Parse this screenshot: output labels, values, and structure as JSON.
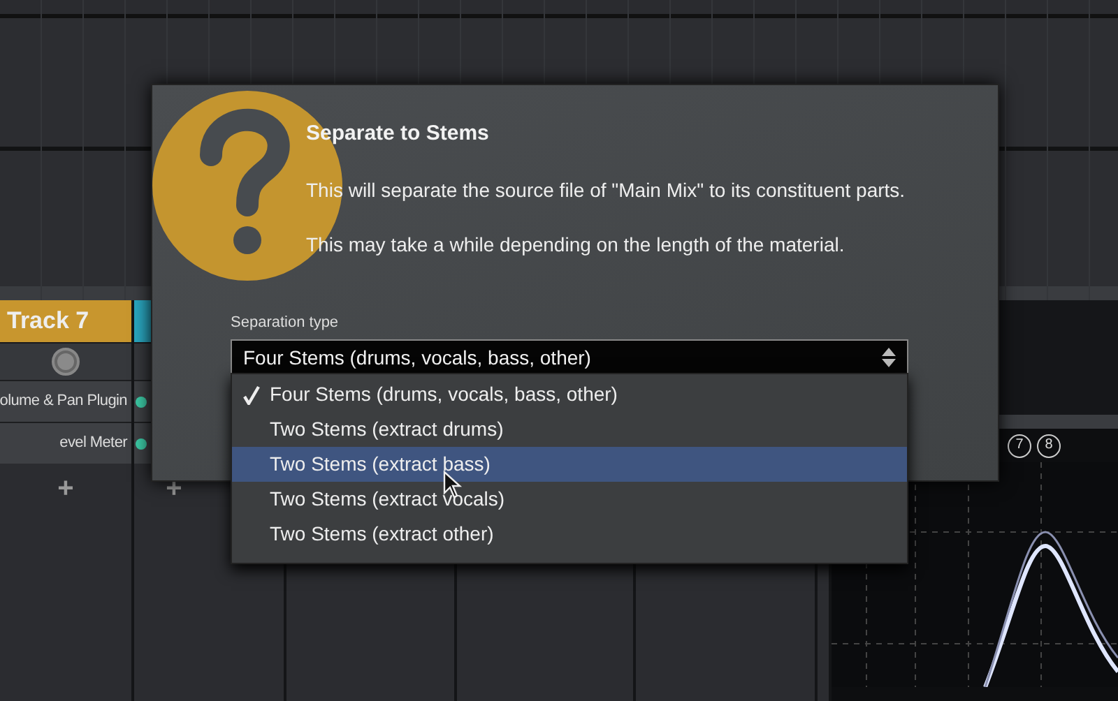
{
  "mixer": {
    "tracks": [
      {
        "name": "Track 7",
        "color": "#c8962e",
        "plugins": [
          {
            "name": "olume & Pan Plugin"
          },
          {
            "name": "evel Meter"
          }
        ],
        "add": "+"
      },
      {
        "color": "#2aa7c0",
        "plugins": [
          {
            "color": "#3cc9a5"
          },
          {
            "color": "#3cc9a5"
          }
        ],
        "add": "+"
      }
    ]
  },
  "eq": {
    "bands": [
      "7",
      "8"
    ]
  },
  "dialog": {
    "title": "Separate to Stems",
    "messages": [
      "This will separate the source file of \"Main Mix\" to its constituent parts.",
      "This may take a while depending on the length of the material."
    ],
    "field_label": "Separation type",
    "select": {
      "value": "Four Stems (drums, vocals, bass, other)"
    },
    "menu": [
      {
        "label": "Four Stems (drums, vocals, bass, other)",
        "checked": true,
        "selected": false
      },
      {
        "label": "Two Stems (extract drums)",
        "checked": false,
        "selected": false
      },
      {
        "label": "Two Stems (extract bass)",
        "checked": false,
        "selected": true
      },
      {
        "label": "Two Stems (extract vocals)",
        "checked": false,
        "selected": false
      },
      {
        "label": "Two Stems (extract other)",
        "checked": false,
        "selected": false
      }
    ]
  }
}
